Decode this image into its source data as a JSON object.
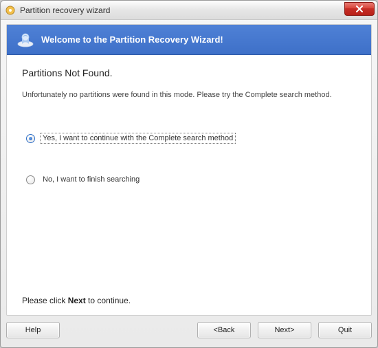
{
  "window": {
    "title": "Partition recovery wizard"
  },
  "banner": {
    "text": "Welcome to the Partition Recovery Wizard!"
  },
  "page": {
    "heading": "Partitions Not Found.",
    "description": "Unfortunately no partitions were found in this mode. Please try the Complete search method.",
    "option_yes": "Yes, I want to continue with the Complete search method",
    "option_no": "No, I want to finish searching",
    "selected": "yes",
    "footer_pre": "Please click ",
    "footer_bold": "Next",
    "footer_post": " to continue."
  },
  "buttons": {
    "help": "Help",
    "back": "<Back",
    "next": "Next>",
    "quit": "Quit"
  }
}
